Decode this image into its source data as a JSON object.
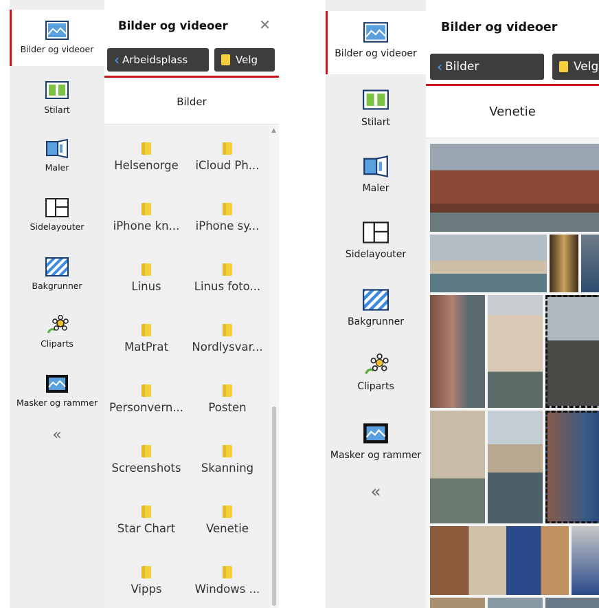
{
  "left_panel": {
    "sidebar": {
      "items": [
        {
          "label": "Bilder og videoer",
          "icon": "image-icon",
          "active": true
        },
        {
          "label": "Stilart",
          "icon": "style-icon"
        },
        {
          "label": "Maler",
          "icon": "template-icon"
        },
        {
          "label": "Sidelayouter",
          "icon": "layout-icon"
        },
        {
          "label": "Bakgrunner",
          "icon": "background-icon"
        },
        {
          "label": "Cliparts",
          "icon": "clipart-icon"
        },
        {
          "label": "Masker og rammer",
          "icon": "frame-icon"
        }
      ],
      "collapse": "«"
    },
    "header": {
      "title": "Bilder og videoer",
      "close": "✕"
    },
    "toolbar": {
      "back_label": "Arbeidsplass",
      "select_label": "Velg"
    },
    "folder_title": "Bilder",
    "folders": [
      "Helsenorge",
      "iCloud Ph...",
      "iPhone kn...",
      "iPhone sy...",
      "Linus",
      "Linus foto...",
      "MatPrat",
      "Nordlysvar...",
      "Personvern...",
      "Posten",
      "Screenshots",
      "Skanning",
      "Star Chart",
      "Venetie",
      "Vipps",
      "Windows ..."
    ]
  },
  "right_panel": {
    "sidebar": {
      "items": [
        {
          "label": "Bilder og videoer",
          "icon": "image-icon",
          "active": true
        },
        {
          "label": "Stilart",
          "icon": "style-icon"
        },
        {
          "label": "Maler",
          "icon": "template-icon"
        },
        {
          "label": "Sidelayouter",
          "icon": "layout-icon"
        },
        {
          "label": "Bakgrunner",
          "icon": "background-icon"
        },
        {
          "label": "Cliparts",
          "icon": "clipart-icon"
        },
        {
          "label": "Masker og rammer",
          "icon": "frame-icon"
        }
      ],
      "collapse": "«"
    },
    "header": {
      "title": "Bilder og videoer"
    },
    "toolbar": {
      "back_label": "Bilder",
      "select_label": "Velg"
    },
    "folder_title": "Venetie"
  },
  "colors": {
    "accent_red": "#c8161d",
    "button_dark": "#3d3d3d",
    "folder_yellow": "#f6cf3c",
    "sidebar_bg": "#eeeeee"
  }
}
